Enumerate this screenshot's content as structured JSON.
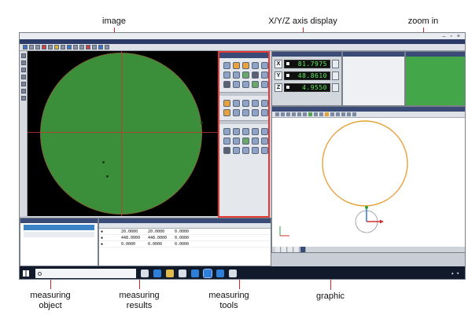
{
  "callouts": {
    "image": "image",
    "xyz_display": "X/Y/Z axis display",
    "zoom_in": "zoom in",
    "measuring_object": "measuring\nobject",
    "measuring_results": "measuring\nresults",
    "measuring_tools": "measuring\ntools",
    "graphic": "graphic"
  },
  "dro": {
    "x_label": "X",
    "y_label": "Y",
    "z_label": "Z",
    "x_value": "81.7975",
    "y_value": "48.8610",
    "z_value": "4.9550"
  },
  "results": {
    "rows": [
      {
        "c1": "20.0000",
        "c2": "20.0000",
        "c3": "0.0000"
      },
      {
        "c1": "448.0000",
        "c2": "448.0000",
        "c3": "0.0000"
      },
      {
        "c1": "0.0000",
        "c2": "0.0000",
        "c3": "0.0000"
      }
    ]
  },
  "colors": {
    "callout_line": "#d2262b",
    "image_green": "#3c8f3a",
    "graphic_circle": "#e8a13a",
    "dro_text": "#5cf05c"
  },
  "icons": [
    "windows-start-icon",
    "search-icon",
    "edge-icon",
    "folder-icon",
    "store-icon",
    "mail-icon",
    "app-icon"
  ]
}
